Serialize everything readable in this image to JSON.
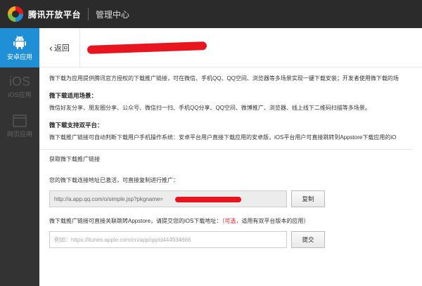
{
  "header": {
    "brand": "腾讯开放平台",
    "subtitle": "管理中心"
  },
  "sidebar": {
    "items": [
      {
        "label": "安卓应用",
        "icon": "android-icon",
        "active": true
      },
      {
        "label": "iOS应用",
        "icon": "ios-icon",
        "glyph": "iOS",
        "active": false
      },
      {
        "label": "网页应用",
        "icon": "web-icon",
        "active": false
      }
    ]
  },
  "page": {
    "back_label": "返回"
  },
  "content": {
    "intro": "微下载为应用提供腾讯官方授权的下载推广链接，可在微信、手机QQ、QQ空间、浏览器等多场景实现一键下载安装；开发者使用微下载的场",
    "scenes_title": "微下载适用场景：",
    "scenes_text": "微信好友分享、朋友圈分享、公众号、微信扫一扫、手机QQ分享、QQ空间、微博推广、浏览器、线上线下二维码扫描等多场景。",
    "dual_title": "微下载支持双平台：",
    "dual_text": "微下载推广链接可自动判断下载用户手机操作系统：安卓平台用户直接下载应用的安卓版，iOS平台用户可直接跳转到Appstore下载应用的iO",
    "section_title": "获取微下载推广链接",
    "activated_text": "您的微下载连接地址已激活，可直接复制进行推广：",
    "link_value": "http://a.app.qq.com/o/simple.jsp?pkgname=",
    "copy_button": "复制",
    "appstore_text_1": "微下载推广链接可直接关联跳转Appstore，请提交您的iOS下载地址：",
    "appstore_optional": "（可选，",
    "appstore_text_2": "适用有双平台版本的应用）",
    "ios_input_placeholder": "例如：https://itunes.apple.com/cn/app/qq/id444934666",
    "submit_button": "提交"
  },
  "colors": {
    "accent": "#1f8fd6",
    "topbar": "#2b2b2b",
    "sidebar": "#333333",
    "redaction": "#e8141e"
  }
}
